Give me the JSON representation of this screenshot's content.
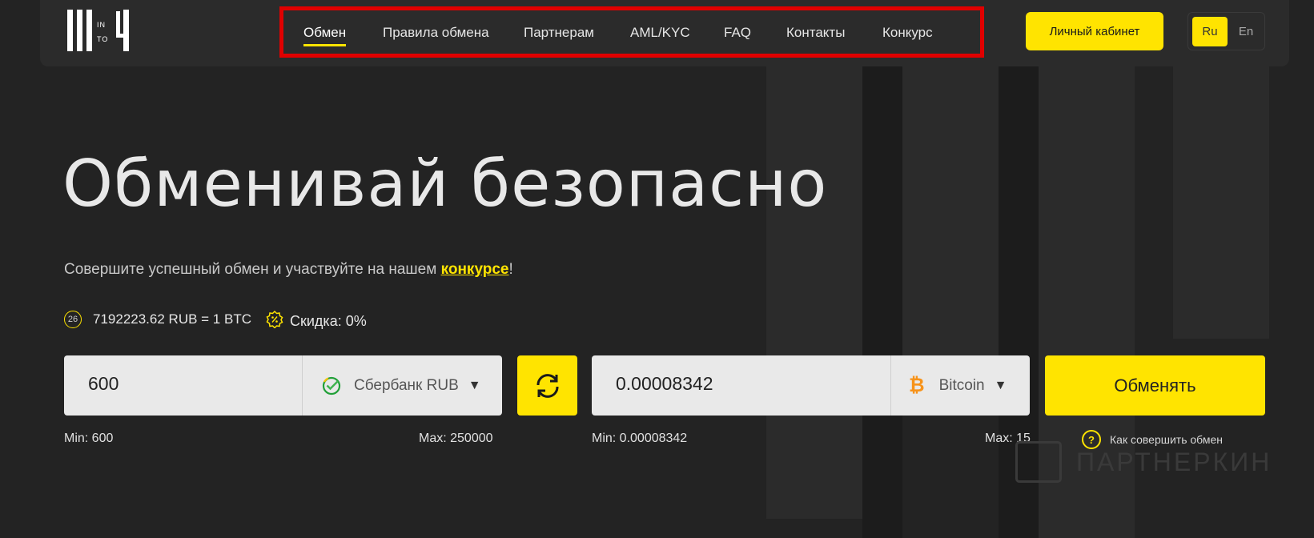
{
  "logo": {
    "text_in": "IN",
    "text_to": "TO"
  },
  "nav": {
    "items": [
      {
        "label": "Обмен",
        "active": true
      },
      {
        "label": "Правила обмена"
      },
      {
        "label": "Партнерам"
      },
      {
        "label": "AML/KYC"
      },
      {
        "label": "FAQ"
      },
      {
        "label": "Контакты"
      },
      {
        "label": "Конкурс"
      }
    ]
  },
  "header": {
    "cabinet_label": "Личный кабинет",
    "lang_ru": "Ru",
    "lang_en": "En"
  },
  "hero": {
    "title": "Обменивай безопасно",
    "subtitle_before": "Совершите успешный обмен и участвуйте на нашем ",
    "subtitle_link": "конкурсе",
    "subtitle_after": "!"
  },
  "rate": {
    "timer": "26",
    "text": "7192223.62 RUB = 1 BTC"
  },
  "discount": {
    "text": "Скидка: 0%"
  },
  "give": {
    "amount": "600",
    "currency": "Сбербанк RUB",
    "min": "Min: 600",
    "max": "Max: 250000"
  },
  "get": {
    "amount": "0.00008342",
    "currency": "Bitcoin",
    "min": "Min: 0.00008342",
    "max": "Max: 15"
  },
  "exchange_label": "Обменять",
  "how_label": "Как совершить обмен",
  "watermark": "ПАРТНЕРКИН",
  "colors": {
    "accent": "#ffe400",
    "background": "#232323",
    "highlight_border": "#e00000"
  },
  "icons": [
    "sberbank-icon",
    "bitcoin-icon",
    "swap-arrows-icon",
    "discount-badge-icon",
    "timer-icon",
    "question-icon",
    "dropdown-arrow-icon"
  ]
}
